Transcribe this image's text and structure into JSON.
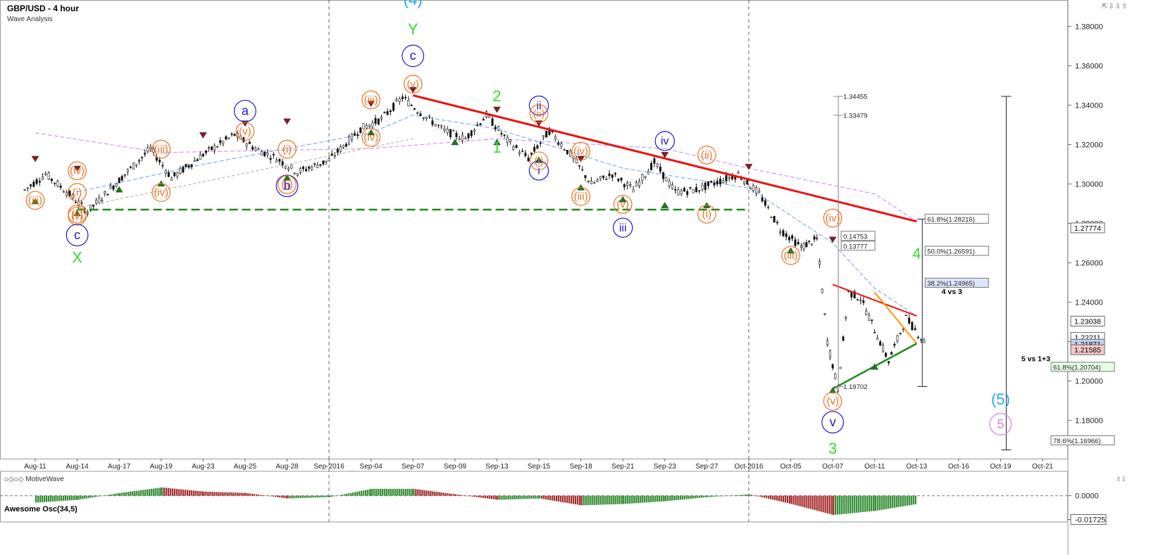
{
  "header": {
    "title": "GBP/USD - 4 hour",
    "subtitle": "Wave Analysis"
  },
  "brand": {
    "label": "MotiveWave"
  },
  "controls": {
    "top": "⇱⇩⇩⇧",
    "bottom": "⇧⇩"
  },
  "indicator": {
    "title": "Awesome Osc(34,5)",
    "axis_ticks": [
      {
        "v": 0.0,
        "label": "0.0000"
      },
      {
        "v": -0.01725,
        "label": "-0.01725",
        "badge": true
      }
    ]
  },
  "colors": {
    "up": "#2e8b2e",
    "down": "#a52a2a",
    "wave_orange": "#f07020",
    "wave_blue": "#1a1acc",
    "wave_green": "#33dd33",
    "wave_cyan": "#22aaee",
    "wave_purple": "#cc88dd",
    "trend_red": "#ee1111",
    "support_green": "#1a8a1a",
    "tri_orange": "#ff9900"
  },
  "chart_data": {
    "type": "candlestick",
    "title": "GBP/USD - 4 hour",
    "ylim": [
      1.162,
      1.392
    ],
    "grid": false,
    "x_labels": [
      "Aug-11",
      "Aug-14",
      "Aug-17",
      "Aug-19",
      "Aug-23",
      "Aug-25",
      "Aug-28",
      "Sep-2016",
      "Sep-04",
      "Sep-07",
      "Sep-09",
      "Sep-13",
      "Sep-15",
      "Sep-18",
      "Sep-21",
      "Sep-23",
      "Sep-27",
      "Oct-2016",
      "Oct-05",
      "Oct-07",
      "Oct-11",
      "Oct-13",
      "Oct-16",
      "Oct-19",
      "Oct-21"
    ],
    "y_ticks": [
      "1.38000",
      "1.36000",
      "1.34000",
      "1.32000",
      "1.30000",
      "1.28000",
      "1.26000",
      "1.24000",
      "1.22000",
      "1.20000",
      "1.18000"
    ],
    "y_tick_values": [
      1.38,
      1.36,
      1.34,
      1.32,
      1.3,
      1.28,
      1.26,
      1.24,
      1.22,
      1.2,
      1.18
    ],
    "price_badges": [
      {
        "label": "1.27774",
        "v": 1.27774
      },
      {
        "label": "1.23038",
        "v": 1.23038
      },
      {
        "label": "1.22211",
        "v": 1.22211
      },
      {
        "label": "1.21871",
        "v": 1.21871,
        "highlight": true
      },
      {
        "label": "1.21585",
        "v": 1.21585,
        "pink": true
      }
    ],
    "month_separators": [
      "Sep-2016",
      "Oct-2016"
    ],
    "series_path": [
      {
        "x": "Aug-11",
        "v": 1.297
      },
      {
        "x": "Aug-11",
        "v": 1.305
      },
      {
        "x": "Aug-14",
        "v": 1.296
      },
      {
        "x": "Aug-14",
        "v": 1.286
      },
      {
        "x": "Aug-17",
        "v": 1.302
      },
      {
        "x": "Aug-19",
        "v": 1.318
      },
      {
        "x": "Aug-19",
        "v": 1.303
      },
      {
        "x": "Aug-23",
        "v": 1.315
      },
      {
        "x": "Aug-25",
        "v": 1.325
      },
      {
        "x": "Aug-25",
        "v": 1.318
      },
      {
        "x": "Aug-28",
        "v": 1.313
      },
      {
        "x": "Aug-28",
        "v": 1.306
      },
      {
        "x": "Sep-2016",
        "v": 1.312
      },
      {
        "x": "Sep-04",
        "v": 1.328
      },
      {
        "x": "Sep-04",
        "v": 1.333
      },
      {
        "x": "Sep-07",
        "v": 1.344
      },
      {
        "x": "Sep-07",
        "v": 1.335
      },
      {
        "x": "Sep-09",
        "v": 1.327
      },
      {
        "x": "Sep-09",
        "v": 1.323
      },
      {
        "x": "Sep-13",
        "v": 1.335
      },
      {
        "x": "Sep-13",
        "v": 1.322
      },
      {
        "x": "Sep-15",
        "v": 1.313
      },
      {
        "x": "Sep-15",
        "v": 1.327
      },
      {
        "x": "Sep-18",
        "v": 1.315
      },
      {
        "x": "Sep-18",
        "v": 1.3
      },
      {
        "x": "Sep-21",
        "v": 1.305
      },
      {
        "x": "Sep-21",
        "v": 1.297
      },
      {
        "x": "Sep-23",
        "v": 1.311
      },
      {
        "x": "Sep-23",
        "v": 1.296
      },
      {
        "x": "Sep-27",
        "v": 1.297
      },
      {
        "x": "Sep-27",
        "v": 1.301
      },
      {
        "x": "Oct-2016",
        "v": 1.305
      },
      {
        "x": "Oct-2016",
        "v": 1.295
      },
      {
        "x": "Oct-05",
        "v": 1.277
      },
      {
        "x": "Oct-05",
        "v": 1.268
      },
      {
        "x": "Oct-07",
        "v": 1.272
      },
      {
        "x": "Oct-07",
        "v": 1.22
      },
      {
        "x": "Oct-07",
        "v": 1.196
      },
      {
        "x": "Oct-07",
        "v": 1.245
      },
      {
        "x": "Oct-11",
        "v": 1.242
      },
      {
        "x": "Oct-11",
        "v": 1.226
      },
      {
        "x": "Oct-11",
        "v": 1.21
      },
      {
        "x": "Oct-13",
        "v": 1.232
      },
      {
        "x": "Oct-13",
        "v": 1.218
      }
    ],
    "moving_averages": [
      {
        "color": "#cc88dd",
        "dash": "6,3",
        "points": [
          {
            "x": "Aug-11",
            "v": 1.326
          },
          {
            "x": "Aug-19",
            "v": 1.316
          },
          {
            "x": "Sep-04",
            "v": 1.318
          },
          {
            "x": "Sep-13",
            "v": 1.323
          },
          {
            "x": "Sep-23",
            "v": 1.318
          },
          {
            "x": "Oct-2016",
            "v": 1.308
          },
          {
            "x": "Oct-11",
            "v": 1.295
          },
          {
            "x": "Oct-13",
            "v": 1.281
          }
        ]
      },
      {
        "color": "#6aa0ee",
        "dash": "6,3",
        "points": [
          {
            "x": "Aug-14",
            "v": 1.296
          },
          {
            "x": "Aug-23",
            "v": 1.31
          },
          {
            "x": "Sep-04",
            "v": 1.326
          },
          {
            "x": "Sep-07",
            "v": 1.335
          },
          {
            "x": "Sep-13",
            "v": 1.328
          },
          {
            "x": "Sep-21",
            "v": 1.308
          },
          {
            "x": "Oct-2016",
            "v": 1.298
          },
          {
            "x": "Oct-07",
            "v": 1.27
          },
          {
            "x": "Oct-11",
            "v": 1.247
          },
          {
            "x": "Oct-13",
            "v": 1.233
          }
        ]
      }
    ],
    "trendlines": [
      {
        "color": "#ee1111",
        "width": 3,
        "from": {
          "x": "Sep-07",
          "v": 1.345
        },
        "to": {
          "x": "Oct-13",
          "v": 1.281
        }
      },
      {
        "color": "#1a8a1a",
        "width": 2.5,
        "dash": "12,6",
        "from": {
          "x": "Aug-14",
          "v": 1.287
        },
        "to": {
          "x": "Oct-2016",
          "v": 1.287
        }
      },
      {
        "color": "#ee1111",
        "width": 2,
        "from": {
          "x": "Oct-07",
          "v": 1.249
        },
        "to": {
          "x": "Oct-13",
          "v": 1.233
        }
      },
      {
        "color": "#ff9900",
        "width": 2,
        "from": {
          "x": "Oct-11",
          "v": 1.245
        },
        "to": {
          "x": "Oct-13",
          "v": 1.219
        }
      },
      {
        "color": "#1a8a1a",
        "width": 2.5,
        "from": {
          "x": "Oct-07",
          "v": 1.196
        },
        "to": {
          "x": "Oct-13",
          "v": 1.219
        }
      },
      {
        "color": "#b8a888",
        "width": 1,
        "dash": "4,3",
        "from": {
          "x": "Aug-14",
          "v": 1.288
        },
        "to": {
          "x": "Sep-07",
          "v": 1.323
        }
      }
    ],
    "wave_labels": [
      {
        "text": "(4)",
        "x": "Sep-07",
        "v": 1.391,
        "color": "#22aaee",
        "size": 22
      },
      {
        "text": "Y",
        "x": "Sep-07",
        "v": 1.376,
        "color": "#33dd33",
        "size": 22
      },
      {
        "text": "c",
        "x": "Sep-07",
        "v": 1.363,
        "color": "#1a1acc",
        "size": 18,
        "circle": true
      },
      {
        "text": "(v)",
        "x": "Sep-07",
        "v": 1.349,
        "color": "#f07020",
        "size": 15,
        "circle": true
      },
      {
        "text": "a",
        "x": "Aug-25",
        "v": 1.335,
        "color": "#1a1acc",
        "size": 18,
        "circle": true
      },
      {
        "text": "(v)",
        "x": "Aug-25",
        "v": 1.325,
        "color": "#f07020",
        "size": 15,
        "circle": true
      },
      {
        "text": "(iii)",
        "x": "Aug-19",
        "v": 1.316,
        "color": "#f07020",
        "size": 15,
        "circle": true
      },
      {
        "text": "(iii)",
        "x": "Sep-04",
        "v": 1.341,
        "color": "#f07020",
        "size": 15,
        "circle": true
      },
      {
        "text": "(iv)",
        "x": "Sep-04",
        "v": 1.322,
        "color": "#f07020",
        "size": 15,
        "circle": true
      },
      {
        "text": "(iv)",
        "x": "Aug-14",
        "v": 1.305,
        "color": "#f07020",
        "size": 15,
        "circle": true
      },
      {
        "text": "(i)",
        "x": "Aug-14",
        "v": 1.294,
        "color": "#f07020",
        "size": 15,
        "circle": true
      },
      {
        "text": "(v)",
        "x": "Aug-14",
        "v": 1.282,
        "color": "#f07020",
        "size": 15,
        "circle": true
      },
      {
        "text": "(ii)",
        "x": "Aug-14",
        "v": 1.283,
        "color": "#f07020",
        "size": 15,
        "circle": true
      },
      {
        "text": "(iii)",
        "x": "Aug-11",
        "v": 1.29,
        "color": "#f07020",
        "size": 15,
        "circle": true
      },
      {
        "text": "c",
        "x": "Aug-14",
        "v": 1.272,
        "color": "#1a1acc",
        "size": 18,
        "circle": true
      },
      {
        "text": "X",
        "x": "Aug-14",
        "v": 1.26,
        "color": "#33dd33",
        "size": 22
      },
      {
        "text": "(iv)",
        "x": "Aug-19",
        "v": 1.294,
        "color": "#f07020",
        "size": 15,
        "circle": true
      },
      {
        "text": "(i)",
        "x": "Aug-28",
        "v": 1.316,
        "color": "#f07020",
        "size": 15,
        "circle": true
      },
      {
        "text": "b",
        "x": "Aug-28",
        "v": 1.297,
        "color": "#1a1acc",
        "size": 18,
        "circle": true
      },
      {
        "text": "(ii)",
        "x": "Aug-28",
        "v": 1.298,
        "color": "#f07020",
        "size": 15,
        "circle": true
      },
      {
        "text": "2",
        "x": "Sep-13",
        "v": 1.342,
        "color": "#33dd33",
        "size": 22
      },
      {
        "text": "1",
        "x": "Sep-13",
        "v": 1.316,
        "color": "#33dd33",
        "size": 22
      },
      {
        "text": "ii",
        "x": "Sep-15",
        "v": 1.338,
        "color": "#1a1acc",
        "size": 16,
        "circle": true
      },
      {
        "text": "(ii)",
        "x": "Sep-15",
        "v": 1.334,
        "color": "#f07020",
        "size": 15,
        "circle": true
      },
      {
        "text": "i",
        "x": "Sep-15",
        "v": 1.305,
        "color": "#1a1acc",
        "size": 16,
        "circle": true
      },
      {
        "text": "(i)",
        "x": "Sep-15",
        "v": 1.31,
        "color": "#f07020",
        "size": 15,
        "circle": true
      },
      {
        "text": "(iv)",
        "x": "Sep-18",
        "v": 1.315,
        "color": "#f07020",
        "size": 15,
        "circle": true
      },
      {
        "text": "(iii)",
        "x": "Sep-18",
        "v": 1.292,
        "color": "#f07020",
        "size": 15,
        "circle": true
      },
      {
        "text": "iv",
        "x": "Sep-23",
        "v": 1.32,
        "color": "#1a1acc",
        "size": 16,
        "circle": true
      },
      {
        "text": "(v)",
        "x": "Sep-21",
        "v": 1.288,
        "color": "#f07020",
        "size": 15,
        "circle": true
      },
      {
        "text": "iii",
        "x": "Sep-21",
        "v": 1.276,
        "color": "#1a1acc",
        "size": 16,
        "circle": true
      },
      {
        "text": "(ii)",
        "x": "Sep-27",
        "v": 1.313,
        "color": "#f07020",
        "size": 15,
        "circle": true
      },
      {
        "text": "(i)",
        "x": "Sep-27",
        "v": 1.283,
        "color": "#f07020",
        "size": 15,
        "circle": true
      },
      {
        "text": "(iv)",
        "x": "Oct-07",
        "v": 1.281,
        "color": "#f07020",
        "size": 15,
        "circle": true
      },
      {
        "text": "(iii)",
        "x": "Oct-05",
        "v": 1.262,
        "color": "#f07020",
        "size": 15,
        "circle": true
      },
      {
        "text": "(v)",
        "x": "Oct-07",
        "v": 1.188,
        "color": "#f07020",
        "size": 15,
        "circle": true
      },
      {
        "text": "v",
        "x": "Oct-07",
        "v": 1.177,
        "color": "#1a1acc",
        "size": 18,
        "circle": true
      },
      {
        "text": "3",
        "x": "Oct-07",
        "v": 1.163,
        "color": "#33dd33",
        "size": 22
      },
      {
        "text": "4",
        "x": "Oct-13",
        "v": 1.262,
        "color": "#33dd33",
        "size": 22
      },
      {
        "text": "(5)",
        "x": "Oct-19",
        "v": 1.188,
        "color": "#22aaee",
        "size": 22
      },
      {
        "text": "5",
        "x": "Oct-19",
        "v": 1.176,
        "color": "#cc88dd",
        "size": 18,
        "circle": true
      }
    ],
    "peak_markers": [
      {
        "x": "Aug-11",
        "v": 1.312
      },
      {
        "x": "Aug-14",
        "v": 1.307
      },
      {
        "x": "Aug-23",
        "v": 1.324
      },
      {
        "x": "Aug-25",
        "v": 1.33
      },
      {
        "x": "Aug-28",
        "v": 1.331
      },
      {
        "x": "Sep-04",
        "v": 1.34
      },
      {
        "x": "Sep-07",
        "v": 1.347
      },
      {
        "x": "Sep-13",
        "v": 1.337
      },
      {
        "x": "Sep-15",
        "v": 1.33
      },
      {
        "x": "Sep-18",
        "v": 1.312
      },
      {
        "x": "Sep-23",
        "v": 1.314
      },
      {
        "x": "Oct-2016",
        "v": 1.308
      },
      {
        "x": "Oct-07",
        "v": 1.271
      }
    ],
    "trough_markers": [
      {
        "x": "Aug-11",
        "v": 1.292
      },
      {
        "x": "Aug-14",
        "v": 1.286
      },
      {
        "x": "Aug-17",
        "v": 1.298
      },
      {
        "x": "Aug-19",
        "v": 1.301
      },
      {
        "x": "Aug-28",
        "v": 1.304
      },
      {
        "x": "Sep-04",
        "v": 1.327
      },
      {
        "x": "Sep-09",
        "v": 1.322
      },
      {
        "x": "Sep-13",
        "v": 1.322
      },
      {
        "x": "Sep-15",
        "v": 1.313
      },
      {
        "x": "Sep-18",
        "v": 1.299
      },
      {
        "x": "Sep-21",
        "v": 1.293
      },
      {
        "x": "Sep-23",
        "v": 1.29
      },
      {
        "x": "Sep-27",
        "v": 1.29
      },
      {
        "x": "Oct-05",
        "v": 1.267
      },
      {
        "x": "Oct-07",
        "v": 1.196
      },
      {
        "x": "Oct-11",
        "v": 1.208
      }
    ],
    "fib_boxes": [
      {
        "label": "1.34455",
        "x": "Oct-07",
        "v": 1.3445
      },
      {
        "label": "1.33479",
        "x": "Oct-07",
        "v": 1.3349
      },
      {
        "label": "0.14753",
        "x": "Oct-07",
        "v": 1.2735,
        "box": true
      },
      {
        "label": "0.13777",
        "x": "Oct-07",
        "v": 1.2685,
        "box": true
      },
      {
        "label": "1.19702",
        "x": "Oct-07",
        "v": 1.1972
      },
      {
        "label": "61.8%(1.28216)",
        "x": "Oct-13",
        "v": 1.2822,
        "box": true
      },
      {
        "label": "50.0%(1.26591)",
        "x": "Oct-13",
        "v": 1.2659,
        "box": true
      },
      {
        "label": "38.2%(1.24965)",
        "x": "Oct-13",
        "v": 1.2497,
        "box": true,
        "fill": "#dde6ff"
      },
      {
        "label": "61.8%(1.20704)",
        "x": "Oct-21",
        "v": 1.207,
        "box": true,
        "fill": "#e6ffe6"
      },
      {
        "label": "78.6%(1.16966)",
        "x": "Oct-21",
        "v": 1.1697,
        "box": true
      }
    ],
    "text_notes": [
      {
        "text": "4 vs 3",
        "x": "Oct-13",
        "v": 1.2455
      },
      {
        "text": "5 vs 1+3",
        "x": "Oct-19",
        "v": 1.2115
      }
    ],
    "measure_lines": [
      {
        "x": "Oct-07",
        "from": 1.3445,
        "to": 1.1972,
        "color": "#888888"
      },
      {
        "x": "Oct-07",
        "from": 1.3349,
        "to": 1.1972,
        "color": "#888888"
      },
      {
        "x": "Oct-13",
        "from": 1.2822,
        "to": 1.1972,
        "color": "#222222"
      },
      {
        "x": "Oct-19",
        "from": 1.3445,
        "to": 1.165,
        "color": "#222222"
      }
    ],
    "awesome_oscillator": [
      {
        "x": "Aug-11",
        "v": -0.005
      },
      {
        "x": "Aug-14",
        "v": -0.003
      },
      {
        "x": "Aug-17",
        "v": 0.002
      },
      {
        "x": "Aug-19",
        "v": 0.006
      },
      {
        "x": "Aug-23",
        "v": 0.003
      },
      {
        "x": "Aug-25",
        "v": 0.002
      },
      {
        "x": "Aug-28",
        "v": -0.002
      },
      {
        "x": "Sep-2016",
        "v": -0.001
      },
      {
        "x": "Sep-04",
        "v": 0.005
      },
      {
        "x": "Sep-07",
        "v": 0.005
      },
      {
        "x": "Sep-09",
        "v": 0.001
      },
      {
        "x": "Sep-13",
        "v": -0.003
      },
      {
        "x": "Sep-15",
        "v": -0.002
      },
      {
        "x": "Sep-18",
        "v": -0.007
      },
      {
        "x": "Sep-21",
        "v": -0.006
      },
      {
        "x": "Sep-23",
        "v": -0.004
      },
      {
        "x": "Sep-27",
        "v": -0.001
      },
      {
        "x": "Oct-2016",
        "v": 0.001
      },
      {
        "x": "Oct-05",
        "v": -0.006
      },
      {
        "x": "Oct-07",
        "v": -0.014
      },
      {
        "x": "Oct-11",
        "v": -0.011
      },
      {
        "x": "Oct-13",
        "v": -0.006
      }
    ]
  }
}
